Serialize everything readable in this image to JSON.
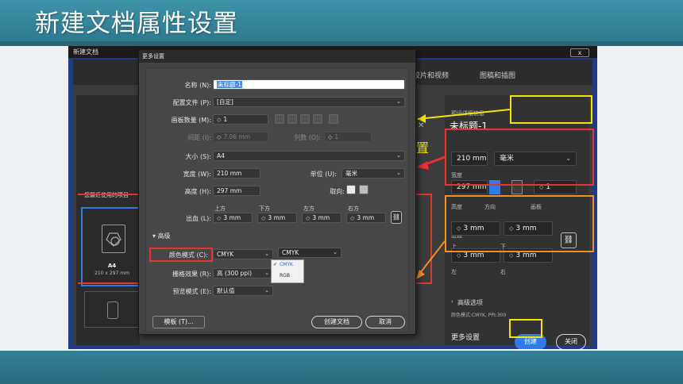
{
  "slide": {
    "title": "新建文档属性设置"
  },
  "window": {
    "title": "新建文档",
    "close_icon": "x-icon",
    "close_glyph": "x"
  },
  "tabs": [
    {
      "label": "胶片和视频"
    },
    {
      "label": "图稿和插图"
    }
  ],
  "recent": {
    "label": "您最近使用的项目",
    "card": {
      "name": "A4",
      "size": "210 x 297 mm"
    }
  },
  "right_pane": {
    "preset_label": "预设详细信息",
    "name": "未标题-1",
    "width_label": "宽度",
    "width_value": "210 mm",
    "unit_value": "毫米",
    "height_label": "高度",
    "height_value": "297 mm",
    "orientation_label": "方向",
    "artboard_label": "画板",
    "artboard_value": "1",
    "bleed_label": "出血",
    "bleed_top_label": "上",
    "bleed_bottom_label": "下",
    "bleed_left_label": "左",
    "bleed_right_label": "右",
    "bleed_top": "3 mm",
    "bleed_bottom": "3 mm",
    "bleed_left": "3 mm",
    "bleed_right": "3 mm",
    "advanced_label": "高级选项",
    "color_info": "颜色模式:CMYK, PPI:300",
    "more_settings": "更多设置",
    "create_label": "创建",
    "close_label": "关闭",
    "side_fragment": "置"
  },
  "more_settings": {
    "title": "更多设置",
    "name_label": "名称 (N):",
    "name_value": "未标题-1",
    "profile_label": "配置文件 (P):",
    "profile_value": "[自定]",
    "artboards_label": "画板数量 (M):",
    "artboards_value": "1",
    "spacing_label": "间距 (I):",
    "spacing_value": "7.06 mm",
    "columns_label": "列数 (O):",
    "columns_value": "1",
    "size_label": "大小 (S):",
    "size_value": "A4",
    "width_label": "宽度 (W):",
    "width_value": "210 mm",
    "units_label": "单位 (U):",
    "units_value": "毫米",
    "height_label": "高度 (H):",
    "height_value": "297 mm",
    "orientation_label": "取向:",
    "bleed_label": "出血 (L):",
    "bleed_top_label": "上方",
    "bleed_bottom_label": "下方",
    "bleed_left_label": "左方",
    "bleed_right_label": "右方",
    "bleed_top": "3 mm",
    "bleed_bottom": "3 mm",
    "bleed_left": "3 mm",
    "bleed_right": "3 mm",
    "advanced_label": "高级",
    "color_mode_label": "颜色模式 (C):",
    "color_mode_value": "CMYK",
    "color_mode_value2": "CMYK",
    "color_options": [
      "CMYK",
      "RGB"
    ],
    "raster_label": "栅格效果 (R):",
    "raster_value": "高 (300 ppi)",
    "preview_label": "预览模式 (E):",
    "preview_value": "默认值",
    "template_button": "模板 (T)...",
    "create_button": "创建文档",
    "cancel_button": "取消"
  },
  "colors": {
    "slide_bar": "#2d7990",
    "accent_blue": "#2f7bea",
    "highlight_yellow": "#f5e400",
    "highlight_red": "#e8322e",
    "highlight_orange": "#f0902a"
  }
}
